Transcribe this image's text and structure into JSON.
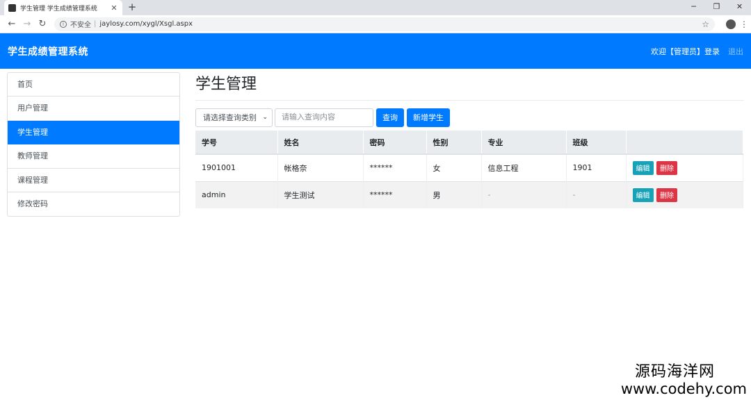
{
  "browser": {
    "tab_title": "学生管理 学生成绩管理系统",
    "tab_close": "✕",
    "new_tab": "+",
    "url": "jaylosy.com/xygl/Xsgl.aspx",
    "security_label": "不安全",
    "security_separator": "|",
    "win_minimize": "─",
    "win_restore": "❐",
    "win_close": "✕"
  },
  "app": {
    "brand": "学生成绩管理系统",
    "welcome": "欢迎【管理员】登录",
    "logout": "退出"
  },
  "sidebar": {
    "items": [
      {
        "label": "首页"
      },
      {
        "label": "用户管理"
      },
      {
        "label": "学生管理",
        "active": true
      },
      {
        "label": "教师管理"
      },
      {
        "label": "课程管理"
      },
      {
        "label": "修改密码"
      }
    ]
  },
  "main": {
    "title": "学生管理",
    "search": {
      "select_value": "请选择查询类别",
      "input_placeholder": "请输入查询内容",
      "query_button": "查询",
      "add_button": "新增学生"
    },
    "table": {
      "headers": [
        "学号",
        "姓名",
        "密码",
        "性别",
        "专业",
        "班级",
        ""
      ],
      "rows": [
        {
          "id": "1901001",
          "name": "帐格奈",
          "password": "******",
          "gender": "女",
          "major": "信息工程",
          "class": "1901",
          "edit": "编辑",
          "delete": "删除"
        },
        {
          "id": "admin",
          "name": "学生测试",
          "password": "******",
          "gender": "男",
          "major": "-",
          "class": "-",
          "edit": "编辑",
          "delete": "删除"
        }
      ]
    }
  },
  "watermark": {
    "cn": "源码海洋网",
    "url": "www.codehy.com"
  }
}
